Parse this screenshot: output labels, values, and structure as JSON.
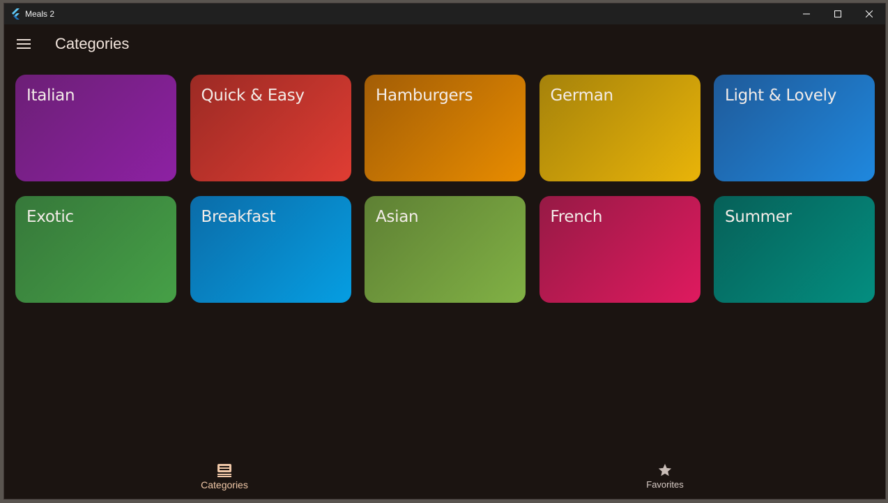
{
  "window": {
    "title": "Meals 2"
  },
  "appbar": {
    "title": "Categories"
  },
  "categories": [
    {
      "label": "Italian",
      "color_from": "#6c1f76",
      "color_to": "#8d21a3"
    },
    {
      "label": "Quick & Easy",
      "color_from": "#9b2a24",
      "color_to": "#e03d33"
    },
    {
      "label": "Hamburgers",
      "color_from": "#a25d06",
      "color_to": "#e88c00"
    },
    {
      "label": "German",
      "color_from": "#a5820b",
      "color_to": "#e9b409"
    },
    {
      "label": "Light & Lovely",
      "color_from": "#1f5a99",
      "color_to": "#1f88de"
    },
    {
      "label": "Exotic",
      "color_from": "#36783a",
      "color_to": "#46a047"
    },
    {
      "label": "Breakfast",
      "color_from": "#0b6ca8",
      "color_to": "#069ee2"
    },
    {
      "label": "Asian",
      "color_from": "#5e8034",
      "color_to": "#81b145"
    },
    {
      "label": "French",
      "color_from": "#961a45",
      "color_to": "#df1a5f"
    },
    {
      "label": "Summer",
      "color_from": "#066058",
      "color_to": "#048e80"
    }
  ],
  "bottom_nav": {
    "items": [
      {
        "label": "Categories",
        "icon": "set-meal-icon",
        "selected": true
      },
      {
        "label": "Favorites",
        "icon": "star-icon",
        "selected": false
      }
    ]
  }
}
